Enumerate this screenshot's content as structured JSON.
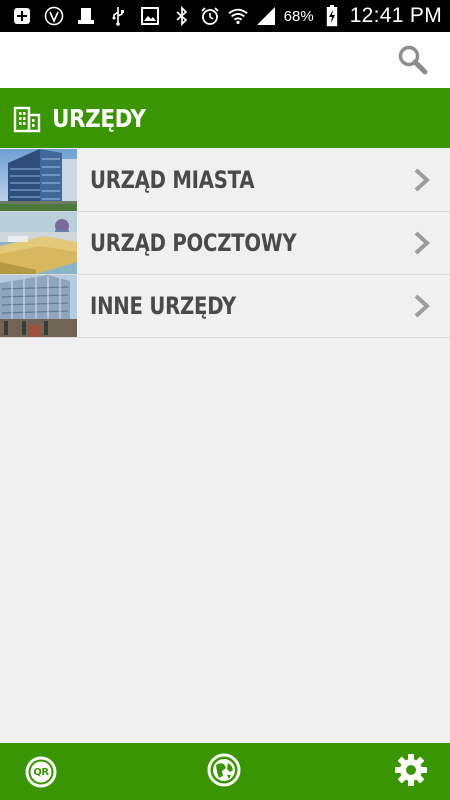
{
  "status_bar": {
    "battery_percent": "68%",
    "time": "12:41 PM",
    "icons": [
      "plus-box-icon",
      "vine-icon",
      "clipboard-icon",
      "usb-icon",
      "image-icon",
      "bluetooth-icon",
      "alarm-icon",
      "wifi-icon",
      "signal-icon",
      "battery-charging-icon"
    ]
  },
  "action_bar": {
    "search_icon": "search-icon"
  },
  "section": {
    "title": "URZĘDY",
    "icon": "building-icon"
  },
  "list": {
    "items": [
      {
        "label": "URZĄD MIASTA",
        "thumb": "city-hall-photo"
      },
      {
        "label": "URZĄD POCZTOWY",
        "thumb": "post-office-photo"
      },
      {
        "label": "INNE URZĘDY",
        "thumb": "other-offices-photo"
      }
    ]
  },
  "bottom_bar": {
    "qr_label": "QR",
    "icons": [
      "qr-icon",
      "globe-icon",
      "gear-icon"
    ]
  },
  "colors": {
    "brand_green": "#3a9600",
    "list_text": "#4a4a4a",
    "background": "#f0f0f0"
  }
}
